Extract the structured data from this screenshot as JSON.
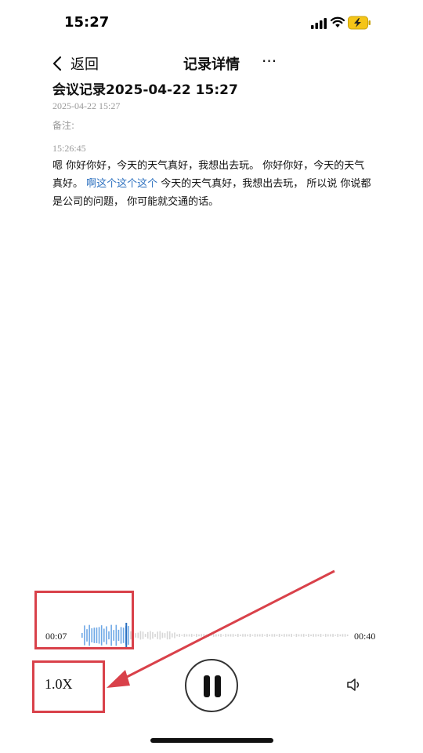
{
  "status_bar": {
    "time": "15:27",
    "icons": [
      "signal-icon",
      "wifi-icon",
      "battery-charging-icon"
    ],
    "battery_color": "#f5c518"
  },
  "nav": {
    "back_label": "返回",
    "title": "记录详情",
    "more_label": "···"
  },
  "record": {
    "title": "会议记录2025-04-22 15:27",
    "date": "2025-04-22 15:27",
    "note_label": "备注:",
    "segment_time": "15:26:45",
    "transcript_parts": [
      "嗯 你好你好，今天的天气真好，我想出去玩。 你好你好，今天的天气真好。 ",
      "啊这个这个这个",
      " 今天的天气真好，我想出去玩， 所以说 你说都是公司的问题， 你可能就交通的话。"
    ],
    "highlight_color": "#2a6fbf"
  },
  "player": {
    "current_time": "00:07",
    "total_time": "00:40",
    "progress": 0.175,
    "speed_label": "1.0X",
    "state": "playing",
    "accent_color": "#6ea8e6"
  },
  "annotations": {
    "color": "#d9414a"
  }
}
